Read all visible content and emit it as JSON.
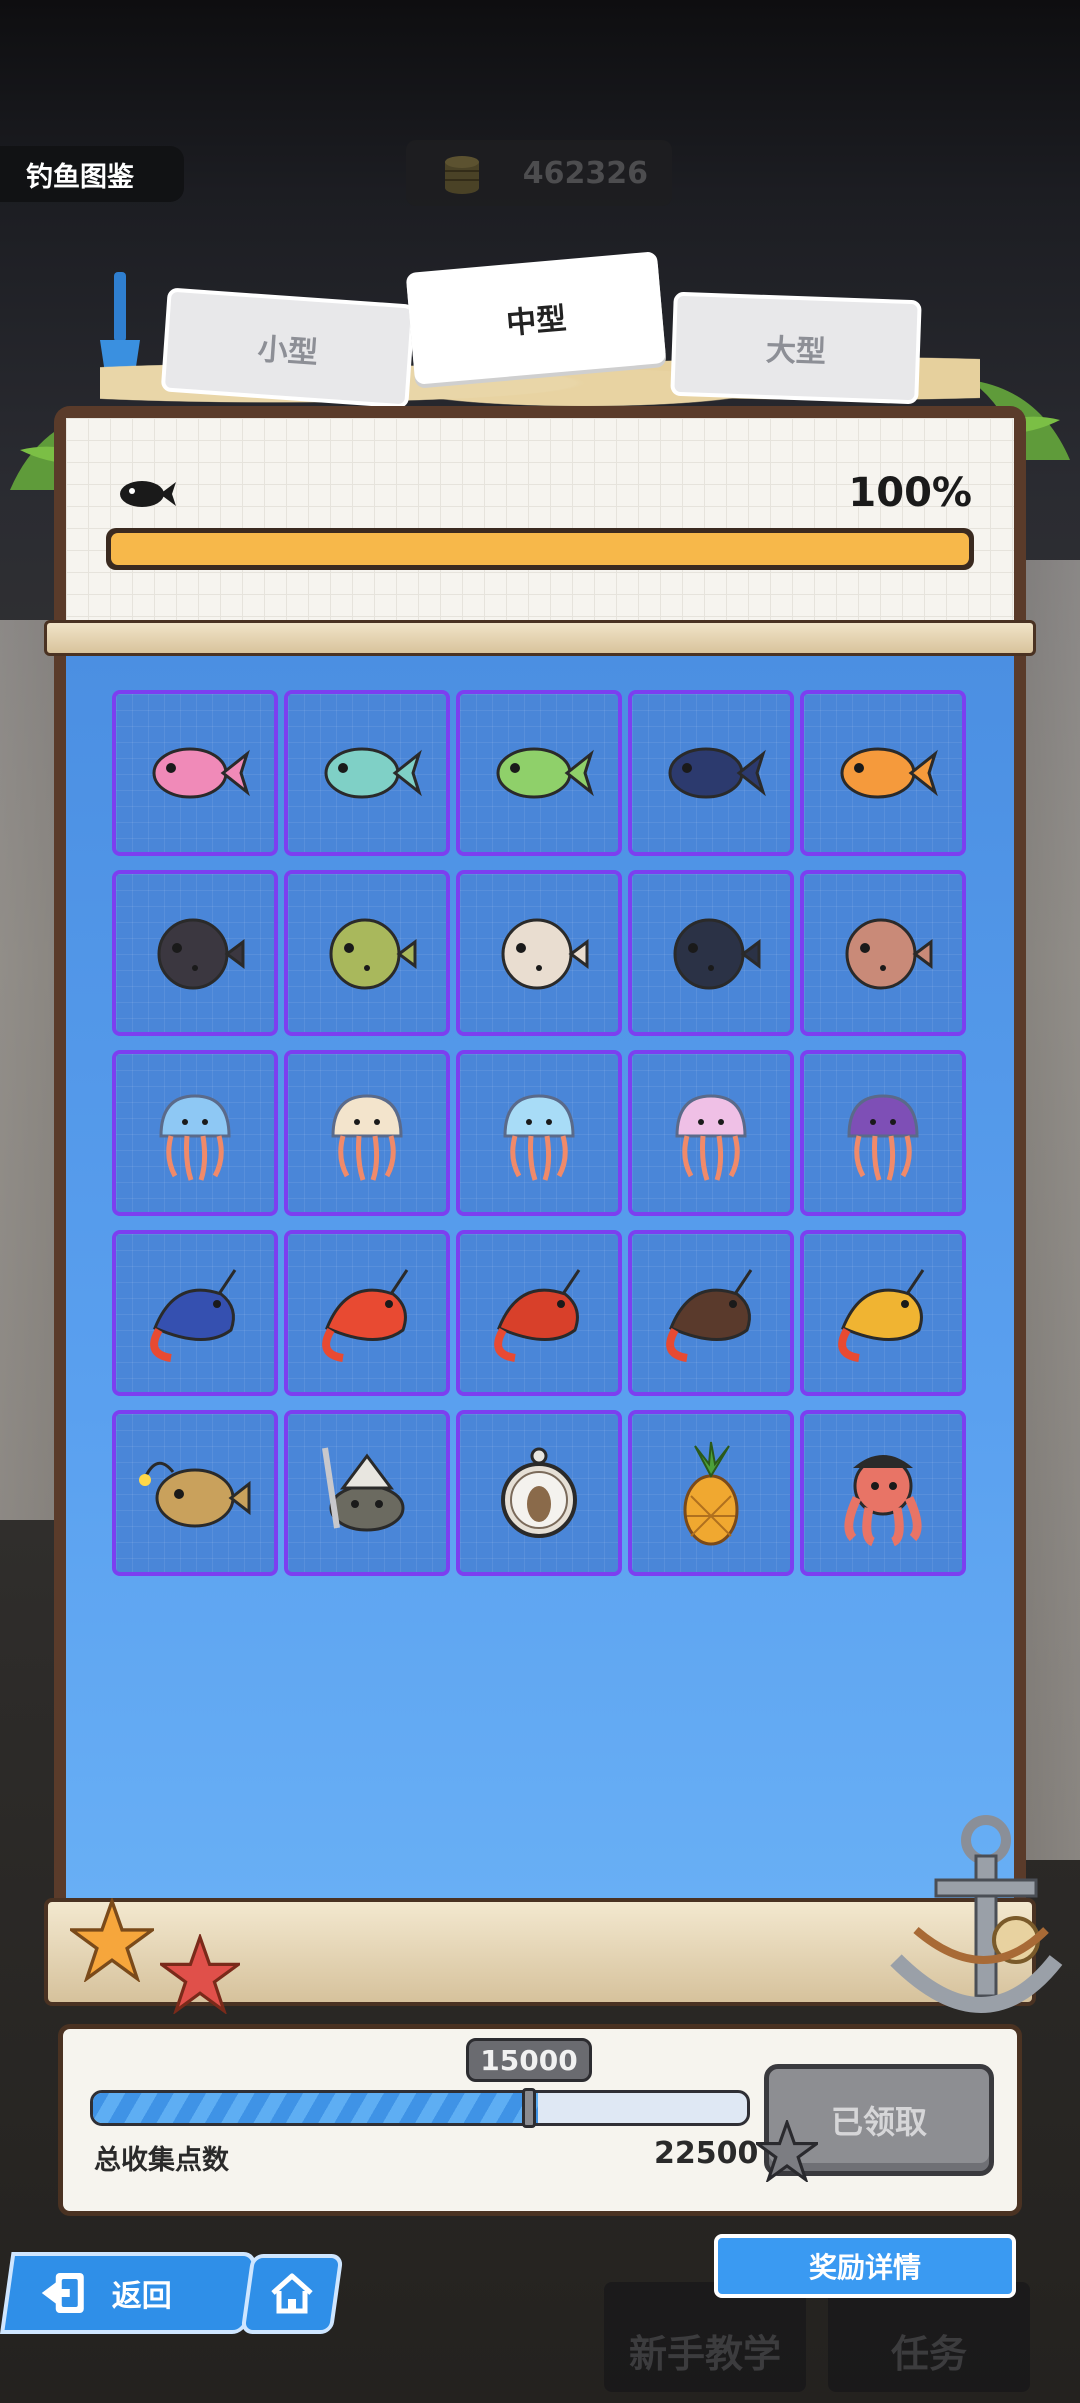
{
  "header": {
    "title": "钓鱼图鉴",
    "coins": "462326"
  },
  "tabs": [
    {
      "label": "小型"
    },
    {
      "label": "中型"
    },
    {
      "label": "大型"
    }
  ],
  "collection": {
    "percent_label": "100%",
    "progress_fraction": 1.0
  },
  "creatures": [
    {
      "icon": "pink-tropical-fish-icon",
      "color": "#f08ab8"
    },
    {
      "icon": "teal-sunfish-icon",
      "color": "#7fd0c6"
    },
    {
      "icon": "green-fish-icon",
      "color": "#8fd06a"
    },
    {
      "icon": "navy-fish-icon",
      "color": "#2c3a6e"
    },
    {
      "icon": "orange-goldfish-icon",
      "color": "#f59a3c"
    },
    {
      "icon": "spiky-pufferfish-icon",
      "color": "#3b3740"
    },
    {
      "icon": "green-pufferfish-icon",
      "color": "#a9b85c"
    },
    {
      "icon": "spotted-pufferfish-icon",
      "color": "#e9ddd0"
    },
    {
      "icon": "dark-pufferfish-icon",
      "color": "#2b3246"
    },
    {
      "icon": "brown-pufferfish-icon",
      "color": "#c98a78"
    },
    {
      "icon": "blue-jellyfish-icon",
      "color": "#8ec8f4"
    },
    {
      "icon": "cream-jellyfish-icon",
      "color": "#f3e4cc"
    },
    {
      "icon": "light-blue-jellyfish-icon",
      "color": "#a8dcf7"
    },
    {
      "icon": "pink-jellyfish-icon",
      "color": "#efc0e6"
    },
    {
      "icon": "purple-jellyfish-icon",
      "color": "#7e4fb6"
    },
    {
      "icon": "blue-shrimp-icon",
      "color": "#3550b0"
    },
    {
      "icon": "red-white-shrimp-icon",
      "color": "#e84a32"
    },
    {
      "icon": "red-shrimp-icon",
      "color": "#d8402a"
    },
    {
      "icon": "brown-shrimp-icon",
      "color": "#5a3a2c"
    },
    {
      "icon": "yellow-shrimp-icon",
      "color": "#f0b432"
    },
    {
      "icon": "anglerfish-icon",
      "color": "#c9a15c"
    },
    {
      "icon": "sword-crab-icon",
      "color": "#6b6a60"
    },
    {
      "icon": "hamster-pendant-icon",
      "color": "#e6e0d6"
    },
    {
      "icon": "pineapple-icon",
      "color": "#f0a830"
    },
    {
      "icon": "pirate-octopus-icon",
      "color": "#e87466"
    }
  ],
  "points": {
    "milestone": "15000",
    "total": "22500",
    "label": "总收集点数",
    "progress_fraction": 0.68,
    "claim_button": "已领取"
  },
  "nav": {
    "reward_details": "奖励详情",
    "back": "返回",
    "tutorial": "新手教学",
    "tasks": "任务"
  }
}
